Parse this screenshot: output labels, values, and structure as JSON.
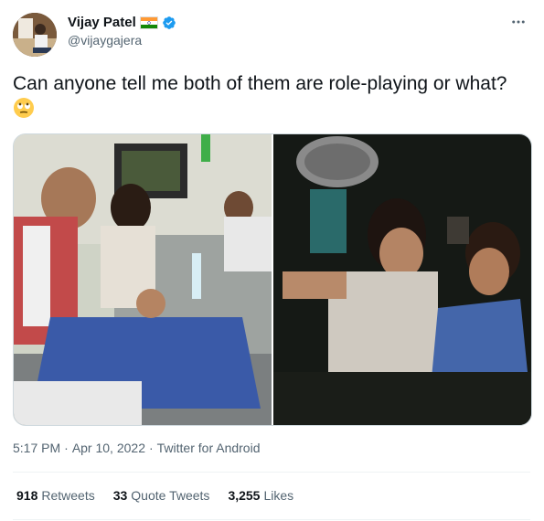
{
  "user": {
    "display_name": "Vijay Patel",
    "handle": "@vijaygajera",
    "flag_icon": "india-flag-icon",
    "verified": true
  },
  "tweet": {
    "text": "Can anyone tell me both of them are role-playing or what?",
    "emoji_icon": "face-with-rolling-eyes-icon"
  },
  "media": [
    {
      "alt": "photo-1"
    },
    {
      "alt": "photo-2"
    }
  ],
  "meta": {
    "time": "5:17 PM",
    "separator": "·",
    "date": "Apr 10, 2022",
    "source": "Twitter for Android"
  },
  "stats": {
    "retweets_count": "918",
    "retweets_label": "Retweets",
    "quotes_count": "33",
    "quotes_label": "Quote Tweets",
    "likes_count": "3,255",
    "likes_label": "Likes"
  },
  "colors": {
    "verified": "#1d9bf0",
    "secondary_text": "#536471",
    "border": "#cfd9de"
  }
}
